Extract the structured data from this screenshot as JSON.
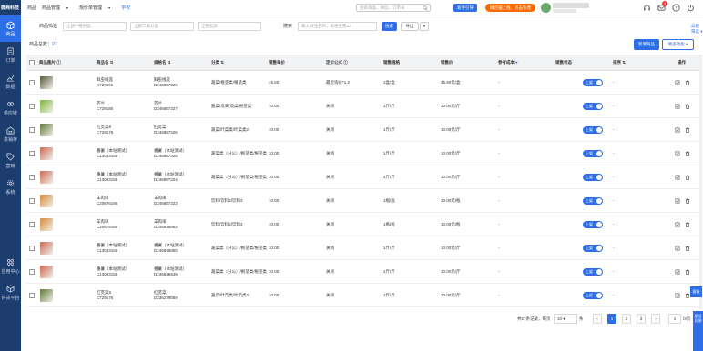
{
  "brand": "微商科技",
  "nav": [
    {
      "label": "商品",
      "icon": "box-icon",
      "active": true
    },
    {
      "label": "订单",
      "icon": "doc-icon"
    },
    {
      "label": "数据",
      "icon": "chart-icon"
    },
    {
      "label": "供应链",
      "icon": "link-icon"
    },
    {
      "label": "进销存",
      "icon": "warehouse-icon"
    },
    {
      "label": "营销",
      "icon": "tag-icon"
    },
    {
      "label": "系统",
      "icon": "gear-icon"
    }
  ],
  "nav_bottom": [
    {
      "label": "应用中心",
      "icon": "apps-icon"
    },
    {
      "label": "供货平台",
      "icon": "cube-icon"
    }
  ],
  "topmenu": {
    "m1": "商品",
    "m2": "商品管理",
    "m3": "规价单管理",
    "m4": "学校"
  },
  "topbar": {
    "search_placeholder": "搜索商品、微信、订单号",
    "btn_new": "新手引导",
    "btn_promo": "微店铺上线，点击免费"
  },
  "filters": {
    "label": "商品筛选",
    "sel1": "全部一级分类",
    "sel2": "全部二级分类",
    "sel3": "全部品牌",
    "search_label": "搜索",
    "search_placeholder": "输入商品名称、规格名或ID",
    "btn_search": "搜索",
    "btn_export": "导出",
    "advanced": "高级筛选"
  },
  "summary": {
    "label": "商品总数：",
    "count": "27"
  },
  "actions": {
    "add": "新增商品",
    "more": "更多功能"
  },
  "columns": {
    "image": "商品图片",
    "name": "商品名",
    "spec": "规格名",
    "category": "分类",
    "price": "销售单价",
    "formula": "定价公式",
    "sale_spec": "销售规格",
    "sale_price": "销售价",
    "ref_cost": "参考成本",
    "status": "销售状态",
    "sort": "排序",
    "ops": "操作"
  },
  "rows": [
    {
      "name": "鲜虫线莲",
      "code": "C729169",
      "spec": "鲜虫线莲",
      "spec_id": "D246857328",
      "category": "蔬菜/根茎类/根茎类",
      "price": "45.60",
      "formula": "最近询价*1.2",
      "sale_spec": "1盒/盒",
      "sale_price": "45.60元/盒",
      "ref_cost": "-",
      "status": "上架",
      "sort": "-",
      "thumb": "#5a5a3a"
    },
    {
      "name": "芥兰",
      "code": "C729180",
      "spec": "芥兰",
      "spec_id": "D246857327",
      "category": "蔬菜/瓜果/瓜类/根茎类",
      "price": "10.00",
      "formula": "关闭",
      "sale_spec": "1斤/斤",
      "sale_price": "10.00元/斤",
      "ref_cost": "-",
      "status": "上架",
      "sort": "-",
      "thumb": "#79b63b"
    },
    {
      "name": "红苋菜8",
      "code": "C729176",
      "spec": "红苋菜",
      "spec_id": "D246857326",
      "category": "蔬菜/叶菜类/叶菜类2",
      "price": "10.00",
      "formula": "关闭",
      "sale_spec": "1斤/斤",
      "sale_price": "10.00元/斤",
      "ref_cost": "-",
      "status": "上架",
      "sort": "-",
      "thumb": "#5d7a3a"
    },
    {
      "name": "番薯（本站测试）",
      "code": "C13033158",
      "spec": "番薯（本站测试）",
      "spec_id": "D246857325",
      "category": "蔬菜类（分公）/根茎类/根茎类",
      "price": "10.00",
      "formula": "关闭",
      "sale_spec": "1斤/斤",
      "sale_price": "10.00元/斤",
      "ref_cost": "-",
      "status": "上架",
      "sort": "-",
      "thumb": "#c96a55"
    },
    {
      "name": "番薯（本站测试）",
      "code": "C13033158",
      "spec": "番薯（本站测试）",
      "spec_id": "D246857324",
      "category": "蔬菜类（分公）/根茎类/根茎类",
      "price": "10.00",
      "formula": "关闭",
      "sale_spec": "1斤/斤",
      "sale_price": "10.00元/斤",
      "ref_cost": "-",
      "status": "上架",
      "sort": "-",
      "thumb": "#c96a55"
    },
    {
      "name": "羊肉串",
      "code": "C20676190",
      "spec": "羊肉串",
      "spec_id": "D246857323",
      "category": "饮料/饮料2/饮料3",
      "price": "10.00",
      "formula": "关闭",
      "sale_spec": "1瓶/瓶",
      "sale_price": "10.00元/瓶",
      "ref_cost": "-",
      "status": "上架",
      "sort": "-",
      "thumb": "#d7893a"
    },
    {
      "name": "羊肉串",
      "code": "C20676190",
      "spec": "羊肉串",
      "spec_id": "D246846852",
      "category": "饮料/饮料2/饮料3",
      "price": "10.00",
      "formula": "关闭",
      "sale_spec": "1瓶/瓶",
      "sale_price": "10.00元/瓶",
      "ref_cost": "-",
      "status": "上架",
      "sort": "-",
      "thumb": "#d7893a"
    },
    {
      "name": "番薯（本站测试）",
      "code": "C13033158",
      "spec": "番薯（本站测试）",
      "spec_id": "D246846850",
      "category": "蔬菜类（分公）/根茎类/根茎类",
      "price": "10.00",
      "formula": "关闭",
      "sale_spec": "1斤/斤",
      "sale_price": "10.00元/斤",
      "ref_cost": "-",
      "status": "上架",
      "sort": "-",
      "thumb": "#c96a55"
    },
    {
      "name": "番薯（本站测试）",
      "code": "C13033158",
      "spec": "番薯（本站测试）",
      "spec_id": "D246846849",
      "category": "蔬菜类（分公）/根茎类/根茎类",
      "price": "10.00",
      "formula": "关闭",
      "sale_spec": "1斤/斤",
      "sale_price": "10.00元/斤",
      "ref_cost": "-",
      "status": "上架",
      "sort": "-",
      "thumb": "#c96a55"
    },
    {
      "name": "红苋菜8",
      "code": "C729176",
      "spec": "红苋菜",
      "spec_id": "D236279569",
      "category": "蔬菜/叶菜类/叶菜类2",
      "price": "10.00",
      "formula": "关闭",
      "sale_spec": "1斤/斤",
      "sale_price": "10.00元/斤",
      "ref_cost": "-",
      "status": "上架",
      "sort": "-",
      "thumb": "#5d7a3a"
    }
  ],
  "pagination": {
    "total_text": "共27条记录，每页",
    "page_size": "10",
    "unit": "条",
    "prev": "‹",
    "pages": [
      "1",
      "2",
      "3"
    ],
    "next": "›",
    "jump_value": "1",
    "jump_suffix": "/3页"
  },
  "side_tabs": {
    "service": "客服",
    "feedback": "意见反馈"
  }
}
